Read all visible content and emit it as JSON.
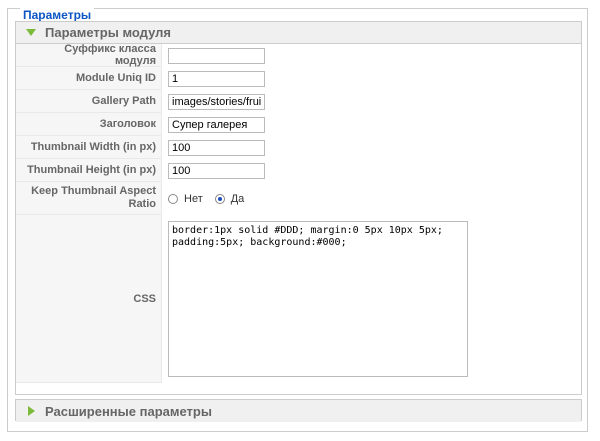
{
  "fieldset": {
    "legend": "Параметры"
  },
  "module_panel": {
    "title": "Параметры модуля",
    "fields": [
      {
        "label": "Суффикс класса модуля",
        "value": ""
      },
      {
        "label": "Module Uniq ID",
        "value": "1"
      },
      {
        "label": "Gallery Path",
        "value": "images/stories/fruit"
      },
      {
        "label": "Заголовок",
        "value": "Супер галерея"
      },
      {
        "label": "Thumbnail Width (in px)",
        "value": "100"
      },
      {
        "label": "Thumbnail Height (in px)",
        "value": "100"
      }
    ],
    "aspect": {
      "label": "Keep Thumbnail Aspect Ratio",
      "options": [
        "Нет",
        "Да"
      ],
      "selected": "Да"
    },
    "css": {
      "label": "CSS",
      "value": "border:1px solid #DDD; margin:0 5px 10px 5px; padding:5px; background:#000;"
    }
  },
  "advanced_panel": {
    "title": "Расширенные параметры"
  }
}
